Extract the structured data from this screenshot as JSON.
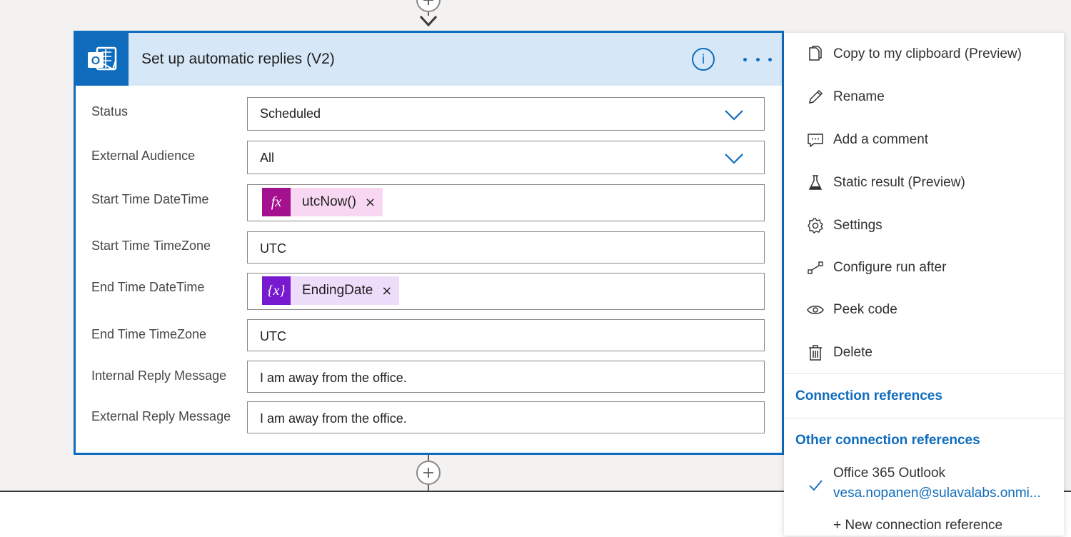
{
  "action": {
    "title": "Set up automatic replies (V2)",
    "info_label": "i",
    "fields": {
      "status": {
        "label": "Status",
        "value": "Scheduled"
      },
      "external_audience": {
        "label": "External Audience",
        "value": "All"
      },
      "start_datetime": {
        "label": "Start Time DateTime",
        "token": "utcNow()",
        "token_icon": "fx",
        "token_color": "#a4118f"
      },
      "start_timezone": {
        "label": "Start Time TimeZone",
        "value": "UTC"
      },
      "end_datetime": {
        "label": "End Time DateTime",
        "token": "EndingDate",
        "token_icon": "{x}",
        "token_color": "#7719ce"
      },
      "end_timezone": {
        "label": "End Time TimeZone",
        "value": "UTC"
      },
      "internal_reply": {
        "label": "Internal Reply Message",
        "value": "I am away from the office."
      },
      "external_reply": {
        "label": "External Reply Message",
        "value": "I am away from the office."
      }
    },
    "token_remove": "×"
  },
  "menu": {
    "items": [
      {
        "label": "Copy to my clipboard (Preview)",
        "icon": "copy-icon"
      },
      {
        "label": "Rename",
        "icon": "pencil-icon"
      },
      {
        "label": "Add a comment",
        "icon": "comment-icon"
      },
      {
        "label": "Static result (Preview)",
        "icon": "flask-icon"
      },
      {
        "label": "Settings",
        "icon": "gear-icon"
      },
      {
        "label": "Configure run after",
        "icon": "run-after-icon"
      },
      {
        "label": "Peek code",
        "icon": "eye-icon"
      },
      {
        "label": "Delete",
        "icon": "trash-icon"
      }
    ],
    "connection_references": "Connection references",
    "other_connection_references": "Other connection references",
    "connection": {
      "name": "Office 365 Outlook",
      "email": "vesa.nopanen@sulavalabs.onmi...",
      "selected": true
    },
    "new_connection": "+ New connection reference"
  },
  "colors": {
    "accent": "#0f6cbd",
    "header_bg": "#d6e8f8",
    "fx_token": "#a4118f",
    "var_token": "#7719ce"
  }
}
